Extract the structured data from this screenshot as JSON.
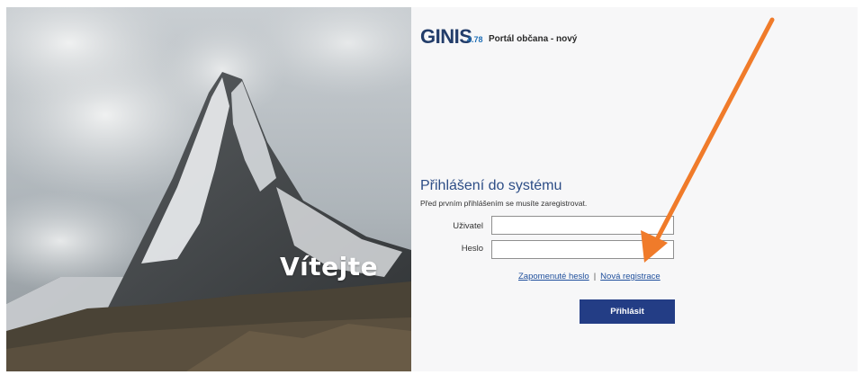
{
  "hero": {
    "welcome_text": "Vítejte"
  },
  "header": {
    "logo_text": "GINIS",
    "version": "4.78",
    "portal_name": "Portál občana - nový"
  },
  "login": {
    "title": "Přihlášení do systému",
    "note": "Před prvním přihlášením se musíte zaregistrovat.",
    "username_label": "Uživatel",
    "username_value": "",
    "password_label": "Heslo",
    "password_value": "",
    "forgot_password_link": "Zapomenuté heslo",
    "separator": "|",
    "register_link": "Nová registrace",
    "submit_label": "Přihlásit"
  },
  "colors": {
    "brand_navy": "#233d85",
    "title_blue": "#2d4d86",
    "link_blue": "#1f4f9c",
    "annotation_arrow": "#f07b2a"
  },
  "annotation": {
    "type": "arrow",
    "points_to": "register-link"
  }
}
